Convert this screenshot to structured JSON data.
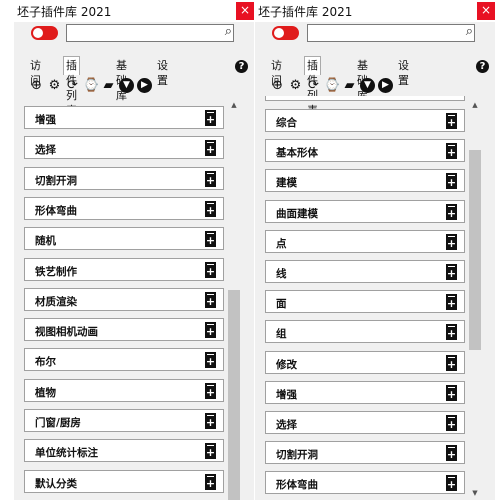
{
  "panels": [
    {
      "title": "坯子插件库 2021",
      "close": "×",
      "tabs": [
        "访问",
        "插件列表",
        "基础库",
        "设置"
      ],
      "help": "?",
      "items": [
        "增强",
        "选择",
        "切割开洞",
        "形体弯曲",
        "随机",
        "铁艺制作",
        "材质渲染",
        "视图相机动画",
        "布尔",
        "植物",
        "门窗/厨房",
        "单位统计标注",
        "默认分类"
      ]
    },
    {
      "title": "坯子插件库 2021",
      "close": "×",
      "tabs": [
        "访问",
        "插件列表",
        "基础库",
        "设置"
      ],
      "help": "?",
      "items": [
        "综合",
        "基本形体",
        "建模",
        "曲面建模",
        "点",
        "线",
        "面",
        "组",
        "修改",
        "增强",
        "选择",
        "切割开洞",
        "形体弯曲"
      ]
    }
  ],
  "toolbar_icons": [
    "add-icon",
    "gear-icon",
    "refresh-icon",
    "clock-delete-icon",
    "folder-icon",
    "download-icon",
    "play-icon"
  ],
  "colors": {
    "toggle": "#e01c1c",
    "close": "#e81123",
    "scroll_thumb": "#c2c2c2"
  }
}
